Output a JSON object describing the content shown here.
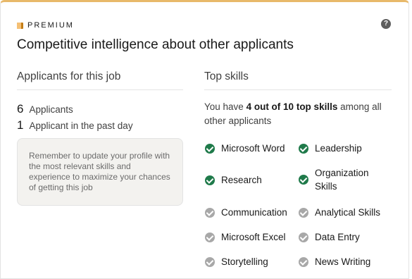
{
  "header": {
    "badge_label": "PREMIUM",
    "help_icon": "question-circle-icon",
    "title": "Competitive intelligence about other applicants"
  },
  "applicants": {
    "heading": "Applicants for this job",
    "total_count": "6",
    "total_label": "Applicants",
    "recent_count": "1",
    "recent_label": "Applicant in the past day",
    "tip": "Remember to update your profile with the most relevant skills and experience to maximize your chances of getting this job"
  },
  "skills": {
    "heading": "Top skills",
    "summary_prefix": "You have ",
    "summary_bold": "4 out of 10 top skills",
    "summary_suffix": " among all other applicants",
    "items": [
      {
        "label": "Microsoft Word",
        "matched": true
      },
      {
        "label": "Leadership",
        "matched": true
      },
      {
        "label": "Research",
        "matched": true
      },
      {
        "label": "Organization Skills",
        "matched": true
      },
      {
        "label": "Communication",
        "matched": false
      },
      {
        "label": "Analytical Skills",
        "matched": false
      },
      {
        "label": "Microsoft Excel",
        "matched": false
      },
      {
        "label": "Data Entry",
        "matched": false
      },
      {
        "label": "Storytelling",
        "matched": false
      },
      {
        "label": "News Writing",
        "matched": false
      }
    ]
  },
  "colors": {
    "accent_bar": "#e8b96a",
    "matched_check": "#1f7a4a",
    "unmatched_check": "#a8a8a8"
  }
}
